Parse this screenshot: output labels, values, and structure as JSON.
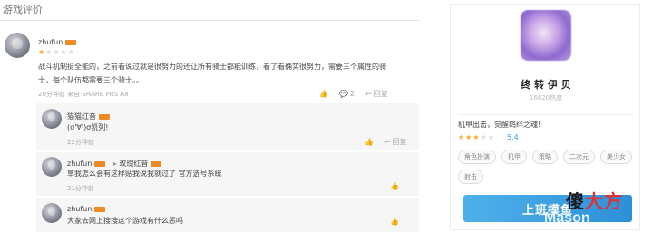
{
  "reviews": {
    "title": "游戏评价",
    "items": [
      {
        "user": "zhufun",
        "stars": 1,
        "max_stars": 5,
        "lines": [
          "战斗机制挺全能的，之前看说过就是很努力的还让所有骑士都能训练，看了看确实很努力，需要三个属性的骑",
          "士，每个队伍都需要三个骑士。。"
        ],
        "meta": "20分钟前 来自 SHARK PRS A8",
        "likes": "",
        "comments": "2",
        "reply_label": "回复",
        "replies": [
          {
            "user": "猫猫红音",
            "text": "(σ'∀')σ凯列!",
            "meta": "22分钟前",
            "reply_label": "回复"
          },
          {
            "user": "zhufun",
            "reply_to": "玫瑰红音",
            "text": "草我怎么会有这样贴我说我就过了 官方选号系统",
            "meta": "21分钟前"
          },
          {
            "user": "zhufun",
            "text": "大家去网上搜搜这个游戏有什么恶吗",
            "meta": ""
          }
        ]
      }
    ]
  },
  "game_card": {
    "name": "终  转   伊  贝",
    "subtitle": "16620热度",
    "slogan": "机甲出击，觉醒羁绊之魂!",
    "stars": 3,
    "max_stars": 5,
    "score": "5.4",
    "tags": [
      "角色扮演",
      "机甲",
      "策略",
      "二次元",
      "美少女",
      "射击"
    ],
    "cta_label": "上班摸鱼"
  },
  "watermark": {
    "text_black": "傻",
    "text_red": "大方",
    "text_sub": "Mason"
  },
  "colors": {
    "accent": "#2d90d8",
    "star": "#f5a623",
    "badge": "#f08a24"
  }
}
